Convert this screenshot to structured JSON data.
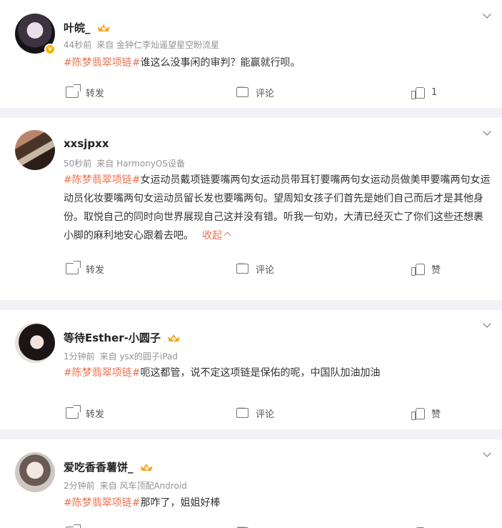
{
  "colors": {
    "accent": "#eb7350",
    "badge": "#f7b500",
    "crown": "#f3a533",
    "background": "#f1f2f5"
  },
  "comments": [
    {
      "name": "叶皖_",
      "has_crown": true,
      "verified": true,
      "time": "44秒前",
      "source": "来自 金钟仁李灿遥望星空盼流星",
      "hashtag": "#陈梦翡翠项链#",
      "text": "谁这么没事闲的审判？能赢就行呗。",
      "repost_label": "转发",
      "comment_label": "评论",
      "like_label": "1"
    },
    {
      "name": "xxsjpxx",
      "has_crown": false,
      "verified": false,
      "time": "50秒前",
      "source": "来自 HarmonyOS设备",
      "hashtag": "#陈梦翡翠项链#",
      "text": "女运动员戴项链要嘴两句女运动员带耳钉要嘴两句女运动员做美甲要嘴两句女运动员化妆要嘴两句女运动员留长发也要嘴两句。望周知女孩子们首先是她们自己而后才是其他身份。取悦自己的同时向世界展现自己这并没有错。听我一句劝，大清已经灭亡了你们这些还想裹小脚的麻利地安心跟着去吧。",
      "fold_label": "收起",
      "repost_label": "转发",
      "comment_label": "评论",
      "like_label": "赞"
    },
    {
      "name": "等待Esther-小圆子",
      "has_crown": true,
      "verified": false,
      "time": "1分钟前",
      "source": "来自 ysx的圆子iPad",
      "hashtag": "#陈梦翡翠项链#",
      "text": "呃这都管，说不定这项链是保佑的呢，中国队加油加油",
      "repost_label": "转发",
      "comment_label": "评论",
      "like_label": "赞"
    },
    {
      "name": "爱吃香香薯饼_",
      "has_crown": true,
      "verified": false,
      "time": "2分钟前",
      "source": "来自 风车顶配Android",
      "hashtag": "#陈梦翡翠项链#",
      "text": "那咋了，姐姐好棒",
      "repost_label": "转发",
      "comment_label": "评论",
      "like_label": "赞"
    }
  ]
}
